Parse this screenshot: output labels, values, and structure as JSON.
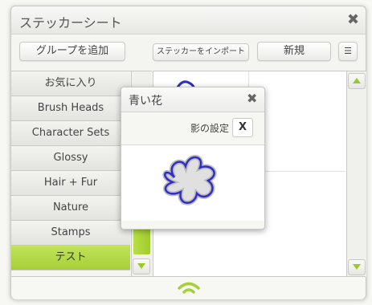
{
  "window": {
    "title": "ステッカーシート"
  },
  "toolbar": {
    "add_group": "グループを追加",
    "import": "ステッカーをインポート",
    "new": "新規"
  },
  "list": {
    "header": "お気に入り",
    "items": [
      {
        "label": "Brush Heads"
      },
      {
        "label": "Character Sets"
      },
      {
        "label": "Glossy"
      },
      {
        "label": "Hair + Fur"
      },
      {
        "label": "Nature"
      },
      {
        "label": "Stamps"
      },
      {
        "label": "テスト",
        "selected": true
      }
    ]
  },
  "popup": {
    "title": "青い花",
    "shadow_label": "影の設定",
    "shadow_button": "X"
  },
  "colors": {
    "accent": "#a7cf37",
    "sticker_stroke": "#2f2fc8"
  }
}
